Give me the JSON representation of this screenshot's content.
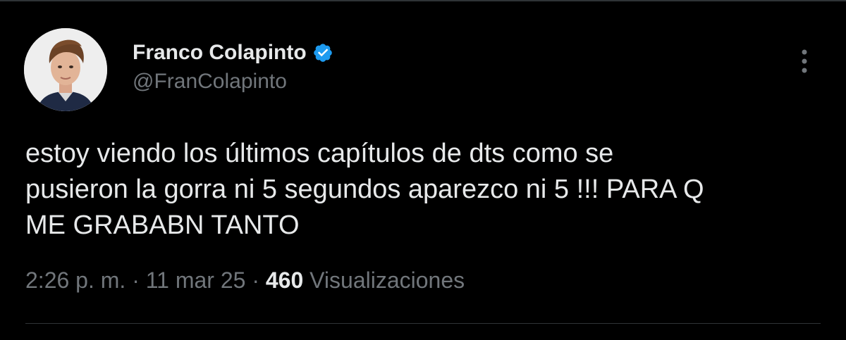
{
  "author": {
    "display_name": "Franco Colapinto",
    "handle": "@FranColapinto",
    "verified": true
  },
  "tweet": {
    "text": "estoy viendo los últimos capítulos de dts como se\npusieron la gorra ni 5 segundos aparezco ni 5 !!! PARA Q\nME GRABABN TANTO",
    "time": "2:26 p. m.",
    "date": "11 mar 25",
    "views_count": "460",
    "views_label": "Visualizaciones",
    "separator": "·"
  },
  "icons": {
    "verified": "verified-badge-icon",
    "more": "more-vertical-icon"
  },
  "colors": {
    "background": "#000000",
    "primary_text": "#e7e9ea",
    "secondary_text": "#71767b",
    "verified_blue": "#1d9bf0",
    "divider": "#2f3336"
  }
}
